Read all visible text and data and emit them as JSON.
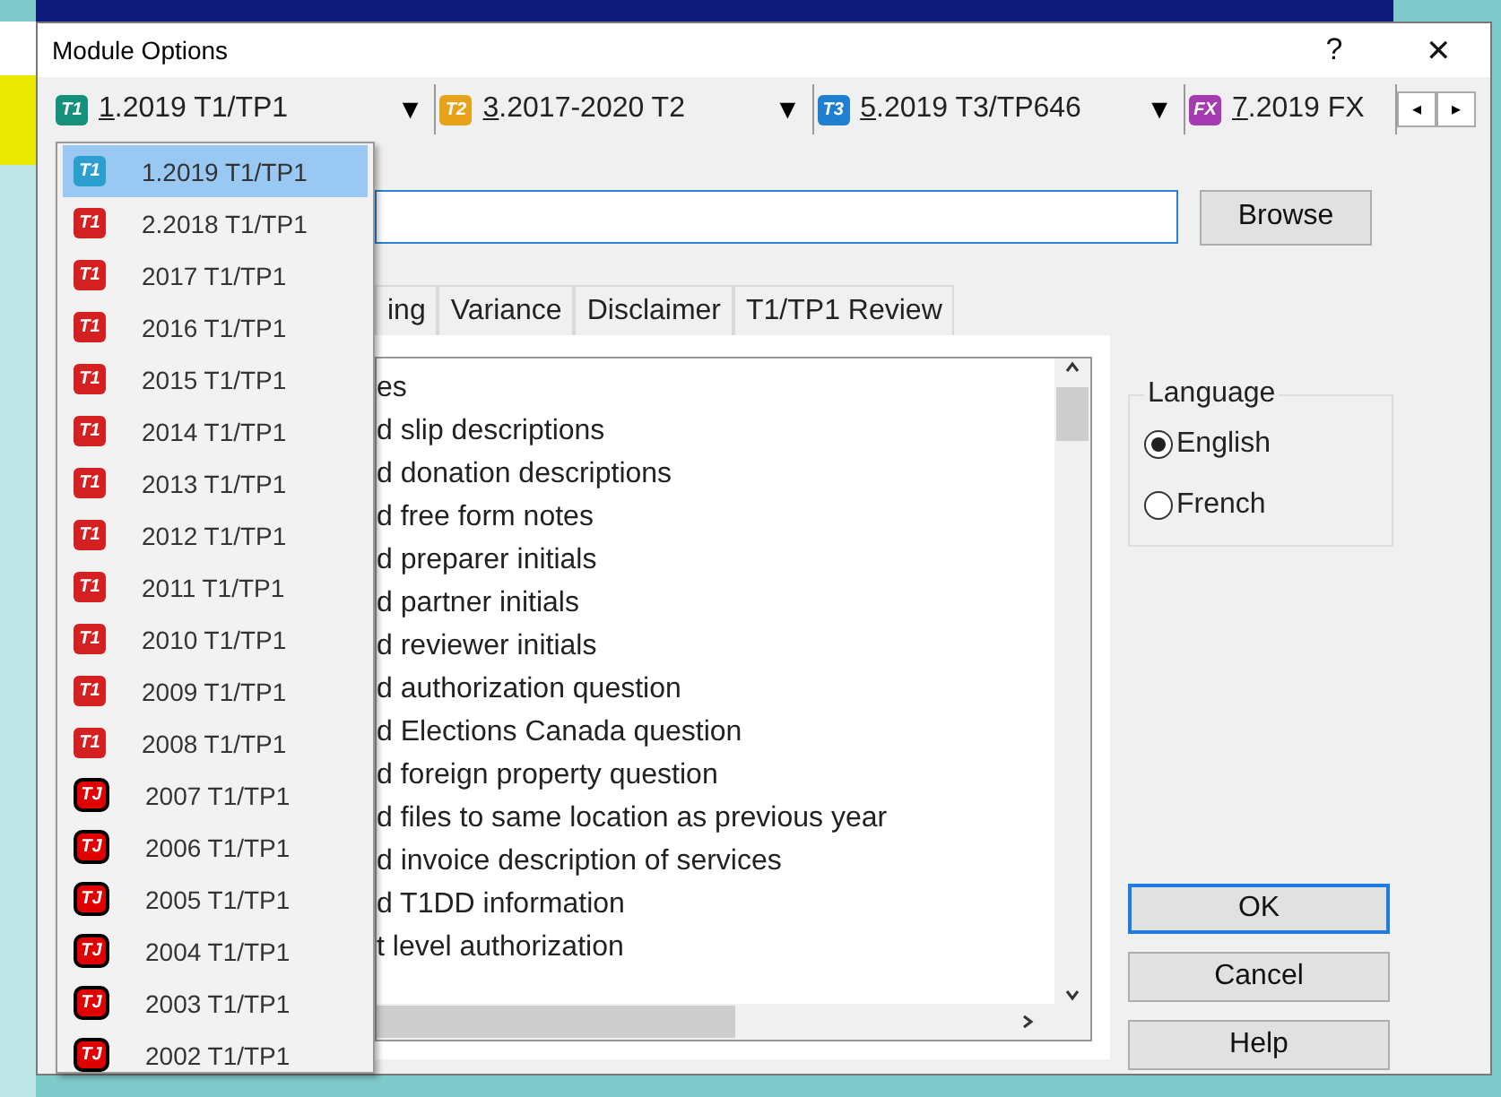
{
  "window": {
    "title": "Module Options",
    "help_glyph": "?",
    "close_glyph": "✕"
  },
  "modules": [
    {
      "badge": "T1",
      "color": "#16907a",
      "label": "1.2019 T1/TP1",
      "arrow": "▼"
    },
    {
      "badge": "T2",
      "color": "#e6a21a",
      "label": "3.2017-2020 T2",
      "arrow": "▼"
    },
    {
      "badge": "T3",
      "color": "#1f7fd0",
      "label": "5.2019 T3/TP646",
      "arrow": "▼"
    },
    {
      "badge": "FX",
      "color": "#a53bb0",
      "label": "7.2019 FX"
    }
  ],
  "module_scroll": {
    "left": "◂",
    "right": "▸"
  },
  "dropdown": [
    {
      "badge": "T1",
      "kind": "current",
      "label": "1.2019 T1/TP1",
      "selected": true
    },
    {
      "badge": "T1",
      "kind": "modern",
      "label": "2.2018 T1/TP1",
      "selected": false
    },
    {
      "badge": "T1",
      "kind": "modern",
      "label": "2017 T1/TP1",
      "selected": false
    },
    {
      "badge": "T1",
      "kind": "modern",
      "label": "2016 T1/TP1",
      "selected": false
    },
    {
      "badge": "T1",
      "kind": "modern",
      "label": "2015 T1/TP1",
      "selected": false
    },
    {
      "badge": "T1",
      "kind": "modern",
      "label": "2014 T1/TP1",
      "selected": false
    },
    {
      "badge": "T1",
      "kind": "modern",
      "label": "2013 T1/TP1",
      "selected": false
    },
    {
      "badge": "T1",
      "kind": "modern",
      "label": "2012 T1/TP1",
      "selected": false
    },
    {
      "badge": "T1",
      "kind": "modern",
      "label": "2011 T1/TP1",
      "selected": false
    },
    {
      "badge": "T1",
      "kind": "modern",
      "label": "2010 T1/TP1",
      "selected": false
    },
    {
      "badge": "T1",
      "kind": "modern",
      "label": "2009 T1/TP1",
      "selected": false
    },
    {
      "badge": "T1",
      "kind": "modern",
      "label": "2008 T1/TP1",
      "selected": false
    },
    {
      "badge": "TJ",
      "kind": "legacy",
      "label": "2007 T1/TP1",
      "selected": false
    },
    {
      "badge": "TJ",
      "kind": "legacy",
      "label": "2006 T1/TP1",
      "selected": false
    },
    {
      "badge": "TJ",
      "kind": "legacy",
      "label": "2005 T1/TP1",
      "selected": false
    },
    {
      "badge": "TJ",
      "kind": "legacy",
      "label": "2004 T1/TP1",
      "selected": false
    },
    {
      "badge": "TJ",
      "kind": "legacy",
      "label": "2003 T1/TP1",
      "selected": false
    },
    {
      "badge": "TJ",
      "kind": "legacy",
      "label": "2002 T1/TP1",
      "selected": false
    }
  ],
  "browse_button": "Browse",
  "tabs": [
    {
      "label": "ing",
      "selected": false
    },
    {
      "label": "Variance",
      "selected": false
    },
    {
      "label": "Disclaimer",
      "selected": false
    },
    {
      "label": "T1/TP1 Review",
      "selected": false
    }
  ],
  "list_items": [
    "es",
    "d slip descriptions",
    "d donation descriptions",
    "d free form notes",
    "d preparer initials",
    "d partner initials",
    "d reviewer initials",
    "d authorization question",
    "d Elections Canada question",
    "d foreign property question",
    "d files to same location as previous year",
    "d invoice description of services",
    "d T1DD information",
    "t level authorization"
  ],
  "language": {
    "title": "Language",
    "options": [
      {
        "label": "English",
        "selected": true
      },
      {
        "label": "French",
        "selected": false
      }
    ]
  },
  "buttons": [
    {
      "label": "OK",
      "focused": true
    },
    {
      "label": "Cancel",
      "focused": false
    },
    {
      "label": "Help",
      "focused": false
    }
  ]
}
